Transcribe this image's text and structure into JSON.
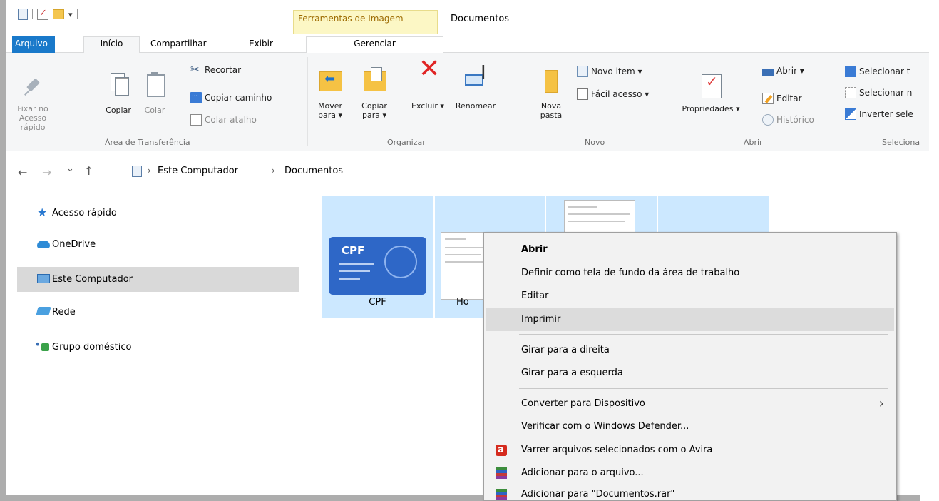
{
  "window": {
    "title": "Documentos",
    "tools_tab": "Ferramentas de Imagem"
  },
  "tabs": {
    "file": "Arquivo",
    "home": "Início",
    "share": "Compartilhar",
    "view": "Exibir",
    "manage": "Gerenciar"
  },
  "ribbon": {
    "clipboard": {
      "pin": "Fixar no Acesso rápido",
      "copy": "Copiar",
      "paste": "Colar",
      "cut": "Recortar",
      "copy_path": "Copiar caminho",
      "paste_shortcut": "Colar atalho",
      "label": "Área de Transferência"
    },
    "organize": {
      "move_to": "Mover para ▾",
      "copy_to": "Copiar para ▾",
      "delete": "Excluir ▾",
      "rename": "Renomear",
      "label": "Organizar"
    },
    "new": {
      "new_folder": "Nova pasta",
      "new_item": "Novo item ▾",
      "easy_access": "Fácil acesso ▾",
      "label": "Novo"
    },
    "open": {
      "properties": "Propriedades ▾",
      "open": "Abrir ▾",
      "edit": "Editar",
      "history": "Histórico",
      "label": "Abrir"
    },
    "select": {
      "select_all": "Selecionar t",
      "select_none": "Selecionar n",
      "invert": "Inverter sele",
      "label": "Seleciona"
    }
  },
  "address": {
    "back": "←",
    "forward": "→",
    "recent": "⌄",
    "up": "↑",
    "crumbs": [
      "Este Computador",
      "Documentos"
    ],
    "sep": "›"
  },
  "nav_pane": {
    "items": [
      {
        "label": "Acesso rápido"
      },
      {
        "label": "OneDrive"
      },
      {
        "label": "Este Computador"
      },
      {
        "label": "Rede"
      },
      {
        "label": "Grupo doméstico"
      }
    ]
  },
  "files": [
    {
      "name": "CPF",
      "thumb_text": "CPF"
    },
    {
      "name": "Ho"
    },
    {
      "name": ""
    },
    {
      "name": ""
    }
  ],
  "context_menu": {
    "items": [
      "Abrir",
      "Definir como tela de fundo da área de trabalho",
      "Editar",
      "Imprimir",
      "Girar para a direita",
      "Girar para a esquerda",
      "Converter para Dispositivo",
      "Verificar com o Windows Defender...",
      "Varrer arquivos selecionados com o Avira",
      "Adicionar para o arquivo...",
      "Adicionar para \"Documentos.rar\""
    ],
    "submenu_arrow": "›"
  },
  "colors": {
    "accent": "#1979ca",
    "selection": "#cce8ff",
    "tools_tab": "#fcf7c5"
  }
}
